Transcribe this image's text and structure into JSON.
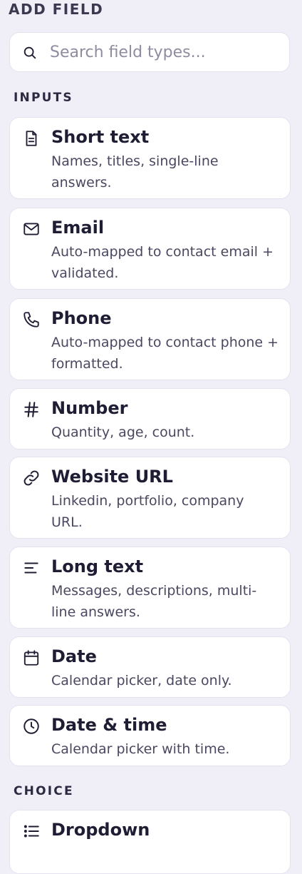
{
  "panel": {
    "title": "ADD FIELD"
  },
  "search": {
    "placeholder": "Search field types...",
    "value": ""
  },
  "sections": {
    "inputs": {
      "label": "INPUTS",
      "items": [
        {
          "name": "Short text",
          "desc": "Names, titles, single-line answers.",
          "icon": "document-icon"
        },
        {
          "name": "Email",
          "desc": "Auto-mapped to contact email + validated.",
          "icon": "mail-icon"
        },
        {
          "name": "Phone",
          "desc": "Auto-mapped to contact phone + formatted.",
          "icon": "phone-icon"
        },
        {
          "name": "Number",
          "desc": "Quantity, age, count.",
          "icon": "hash-icon"
        },
        {
          "name": "Website URL",
          "desc": "Linkedin, portfolio, company URL.",
          "icon": "link-icon"
        },
        {
          "name": "Long text",
          "desc": "Messages, descriptions, multi-line answers.",
          "icon": "align-left-icon"
        },
        {
          "name": "Date",
          "desc": "Calendar picker, date only.",
          "icon": "calendar-icon"
        },
        {
          "name": "Date & time",
          "desc": "Calendar picker with time.",
          "icon": "clock-icon"
        }
      ]
    },
    "choice": {
      "label": "CHOICE",
      "items": [
        {
          "name": "Dropdown",
          "desc": "",
          "icon": "list-icon"
        }
      ]
    }
  }
}
